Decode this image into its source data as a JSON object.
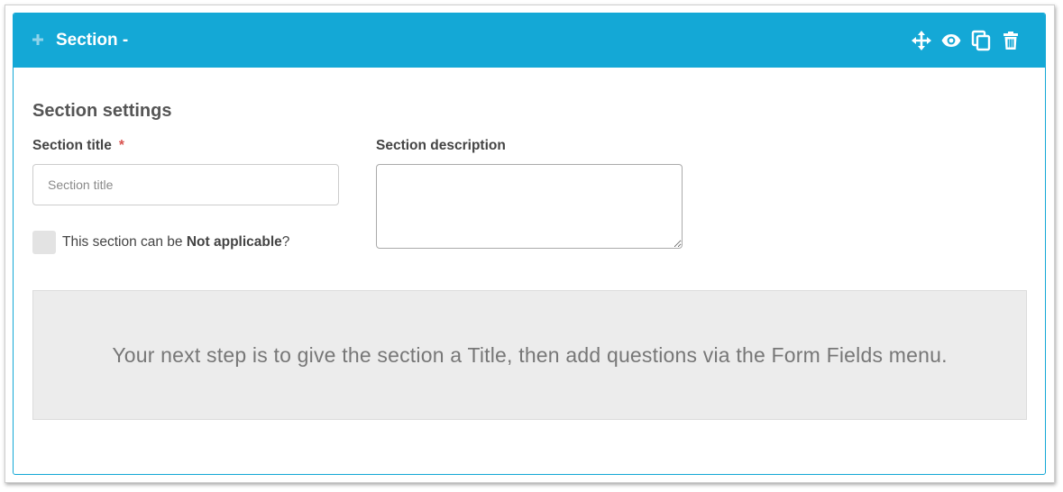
{
  "header": {
    "title": "Section -",
    "background_color": "#14a8d6",
    "icons": [
      "expand-icon",
      "move-icon",
      "preview-eye-icon",
      "duplicate-icon",
      "trash-icon"
    ]
  },
  "settings": {
    "heading": "Section settings",
    "title_field": {
      "label": "Section title",
      "required_marker": "*",
      "placeholder": "Section title",
      "value": ""
    },
    "description_field": {
      "label": "Section description",
      "value": ""
    },
    "not_applicable": {
      "prefix": "This section can be ",
      "emphasis": "Not applicable",
      "suffix": "?",
      "checked": false
    }
  },
  "hint": {
    "text": "Your next step is to give the section a Title, then add questions via the Form Fields menu."
  }
}
